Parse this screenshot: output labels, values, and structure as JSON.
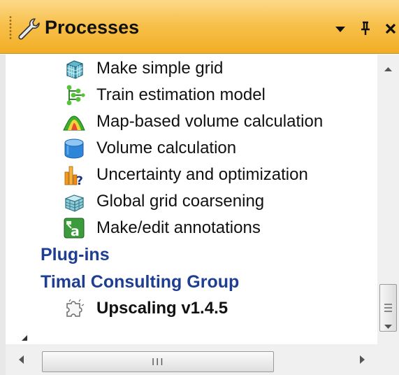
{
  "window": {
    "title": "Processes",
    "icon": "wrench-icon",
    "buttons": {
      "dropdown": "▾",
      "pin": "ᵽ",
      "close": "×"
    }
  },
  "tree": {
    "items": [
      {
        "label": "Make simple grid",
        "icon": "grid-icon"
      },
      {
        "label": "Train estimation model",
        "icon": "network-icon"
      },
      {
        "label": "Map-based volume calculation",
        "icon": "surface-map-icon"
      },
      {
        "label": "Volume calculation",
        "icon": "cylinder-icon"
      },
      {
        "label": "Uncertainty and optimization",
        "icon": "uncertainty-chart-icon"
      },
      {
        "label": "Global grid coarsening",
        "icon": "coarse-grid-icon"
      },
      {
        "label": "Make/edit annotations",
        "icon": "annotation-icon"
      }
    ],
    "categories": {
      "plugins": "Plug-ins",
      "timal": "Timal Consulting Group"
    },
    "plugin_item": {
      "label": "Upscaling v1.4.5",
      "icon": "plugin-puzzle-icon"
    }
  },
  "scrollbars": {
    "horizontal_grip": "III"
  },
  "colors": {
    "title_bar": "#f7c14c",
    "category_text": "#1f3e91"
  }
}
